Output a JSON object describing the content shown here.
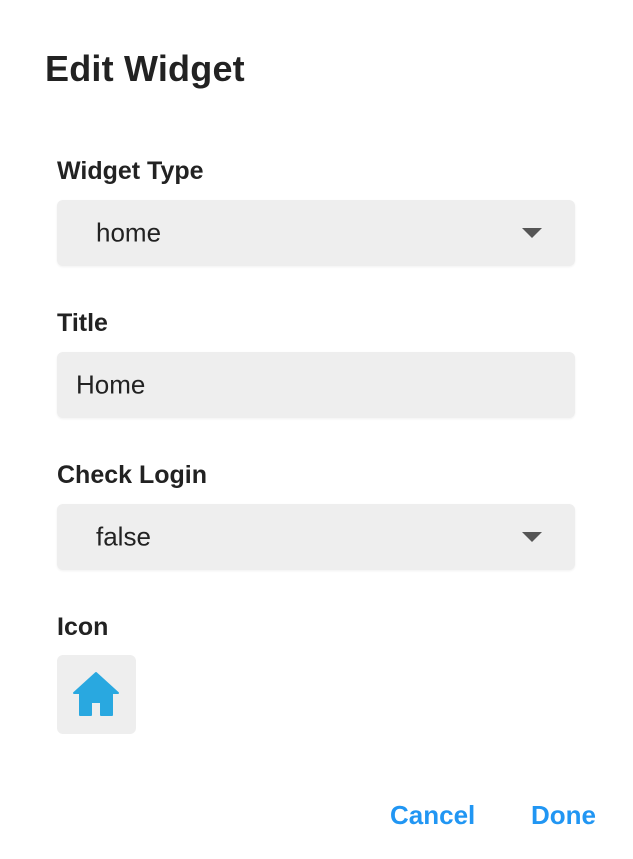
{
  "dialog": {
    "title": "Edit Widget"
  },
  "fields": {
    "widget_type": {
      "label": "Widget Type",
      "value": "home"
    },
    "title": {
      "label": "Title",
      "value": "Home"
    },
    "check_login": {
      "label": "Check Login",
      "value": "false"
    },
    "icon": {
      "label": "Icon",
      "icon_name": "home-icon",
      "icon_color": "#29a8e0"
    }
  },
  "actions": {
    "cancel_label": "Cancel",
    "done_label": "Done",
    "accent_color": "#2196f3"
  }
}
